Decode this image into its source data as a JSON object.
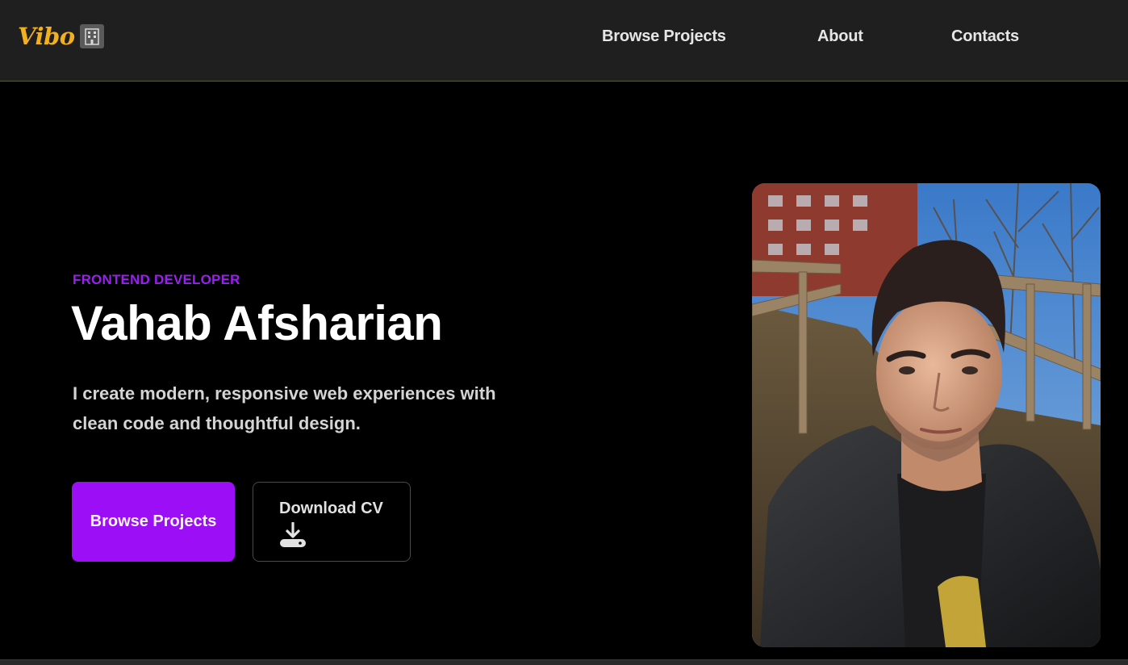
{
  "brand": {
    "name": "Vibo",
    "icon": "building-icon",
    "color": "#f2b01e"
  },
  "nav": {
    "items": [
      {
        "label": "Browse Projects"
      },
      {
        "label": "About"
      },
      {
        "label": "Contacts"
      }
    ]
  },
  "hero": {
    "role": "FRONTEND DEVELOPER",
    "name": "Vahab Afsharian",
    "tagline": "I create modern, responsive web experiences with clean code and thoughtful design.",
    "primary_button": "Browse Projects",
    "secondary_button": "Download CV",
    "secondary_icon": "download-icon",
    "accent": "#9b0ef6"
  }
}
